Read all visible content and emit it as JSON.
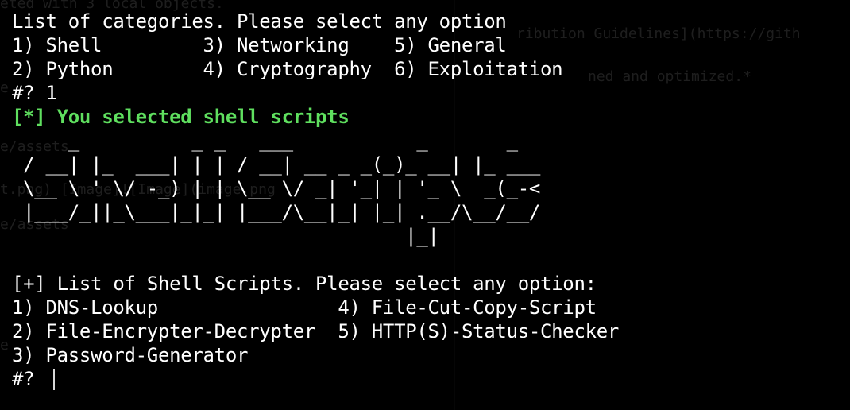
{
  "background_text": {
    "lines": [
      "eted with 3 local objects.",
      "ribution Guidelines](https://gith",
      "ned and optimized.*",
      "e/assets",
      "t.png) [Image]![Image](image.png",
      "e/assets",
      "e",
      "e"
    ]
  },
  "terminal": {
    "menu_header": "List of categories. Please select any option",
    "menu_row1": "1) Shell         3) Networking    5) General",
    "menu_row2": "2) Python        4) Cryptography  6) Exploitation",
    "prompt1": "#? 1",
    "selected_message": "[*] You selected shell scripts",
    "ascii_banner": [
      "     _          _ _   ___           _       _",
      " / __| |_  ___| | | / __| __ _ _(_)_ __| |_ ___",
      " \\__ \\ ' \\/ -_) | | \\__ \\/ _| '_| | '_ \\  _(_-<",
      " |___/_||_\\___|_|_| |___/\\__|_| |_| .__/\\__/__/",
      "                                   |_|"
    ],
    "scripts_header": "[+] List of Shell Scripts. Please select any option:",
    "scripts_row1": "1) DNS-Lookup                4) File-Cut-Copy-Script",
    "scripts_row2": "2) File-Encrypter-Decrypter  5) HTTP(S)-Status-Checker",
    "scripts_row3": "3) Password-Generator",
    "prompt2": "#? "
  },
  "colors": {
    "background": "#000000",
    "text": "#ffffff",
    "accent_green": "#5fdf5f"
  }
}
